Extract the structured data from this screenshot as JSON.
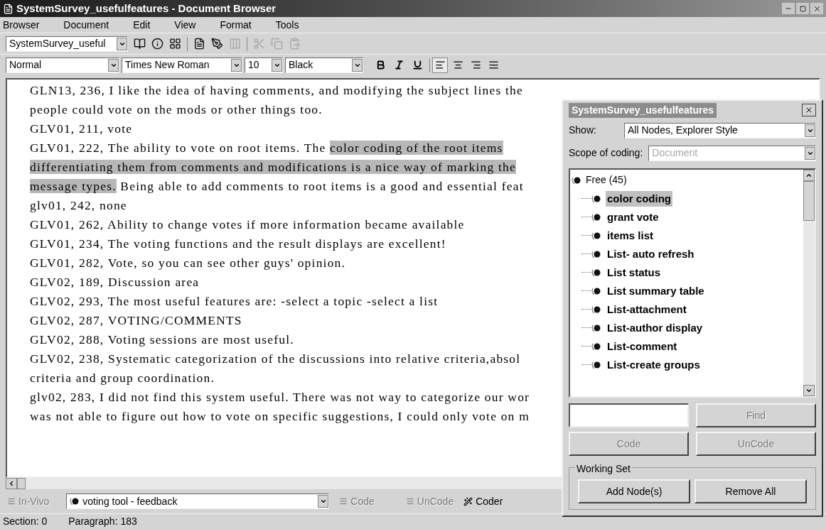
{
  "window": {
    "title": "SystemSurvey_usefulfeatures - Document Browser"
  },
  "menu": [
    {
      "label": "Browser"
    },
    {
      "label": "Document"
    },
    {
      "label": "Edit"
    },
    {
      "label": "View"
    },
    {
      "label": "Format"
    },
    {
      "label": "Tools"
    }
  ],
  "toolbar": {
    "document": "SystemSurvey_useful",
    "tools": [
      {
        "kind": "book",
        "disabled": false
      },
      {
        "kind": "info",
        "disabled": false
      },
      {
        "kind": "grid",
        "disabled": false
      },
      {
        "kind": "document",
        "disabled": false
      },
      {
        "kind": "pen",
        "disabled": false
      },
      {
        "kind": "columns",
        "disabled": true
      },
      {
        "kind": "cut",
        "disabled": true
      },
      {
        "kind": "copy",
        "disabled": true
      },
      {
        "kind": "paste",
        "disabled": true
      }
    ]
  },
  "format_bar": {
    "style": "Normal",
    "font": "Times New Roman",
    "size": "10",
    "color_name": "Black",
    "align": [
      {
        "kind": "left",
        "selected": true
      },
      {
        "kind": "center",
        "selected": false
      },
      {
        "kind": "right",
        "selected": false
      },
      {
        "kind": "justify",
        "selected": false
      }
    ]
  },
  "document": {
    "lines": [
      [
        {
          "text": "GLN13, 236, I like the idea of having comments, and modifying the subject lines the",
          "coded": false
        }
      ],
      [
        {
          "text": "people could vote on the mods or other things too.",
          "coded": false
        }
      ],
      [
        {
          "text": "GLV01, 211, vote",
          "coded": false
        }
      ],
      [
        {
          "text": "GLV01, 222, The ability to vote on root items. The ",
          "coded": false
        },
        {
          "text": "color coding of the root items",
          "coded": true
        }
      ],
      [
        {
          "text": "differentiating them from comments and modifications is a nice way of marking the",
          "coded": true
        }
      ],
      [
        {
          "text": "message types.",
          "coded": true
        },
        {
          "text": " Being able to add comments to root items is a good and essential feat",
          "coded": false
        }
      ],
      [
        {
          "text": "glv01, 242, none",
          "coded": false
        }
      ],
      [
        {
          "text": "GLV01, 262, Ability to change votes if more information became available",
          "coded": false
        }
      ],
      [
        {
          "text": "GLV01, 234, The voting functions and the result displays are excellent!",
          "coded": false
        }
      ],
      [
        {
          "text": "GLV01, 282, Vote, so you can see other guys' opinion.",
          "coded": false
        }
      ],
      [
        {
          "text": "GLV02, 189, Discussion area",
          "coded": false
        }
      ],
      [
        {
          "text": "GLV02, 293, The most useful features are: -select a topic -select a list",
          "coded": false
        }
      ],
      [
        {
          "text": "GLV02, 287, VOTING/COMMENTS",
          "coded": false
        }
      ],
      [
        {
          "text": "GLV02, 288, Voting sessions are most useful.",
          "coded": false
        }
      ],
      [
        {
          "text": "GLV02, 238, Systematic categorization of the discussions into relative criteria,absol",
          "coded": false
        }
      ],
      [
        {
          "text": "criteria and group coordination.",
          "coded": false
        }
      ],
      [
        {
          "text": "glv02, 283, I did not find this system useful. There was not way to categorize our wor",
          "coded": false
        }
      ],
      [
        {
          "text": "was not able to figure out how to vote on specific suggestions, I could only vote on m",
          "coded": false
        }
      ]
    ]
  },
  "coding_bar": {
    "in_vivo": {
      "label": "In-Vivo",
      "disabled": true
    },
    "node": "voting tool - feedback",
    "code": {
      "label": "Code",
      "disabled": true
    },
    "uncode": {
      "label": "UnCode",
      "disabled": true
    },
    "coder": {
      "label": "Coder",
      "disabled": false
    }
  },
  "status_bar": {
    "section": "Section: 0",
    "paragraph": "Paragraph: 183"
  },
  "dialog": {
    "title": "SystemSurvey_usefulfeatures",
    "show_label": "Show:",
    "show_value": "All Nodes, Explorer Style",
    "scope_label": "Scope of coding:",
    "scope_value": "Document",
    "scope_disabled": true,
    "tree": {
      "label": "Free (45)",
      "children": [
        {
          "label": "color coding",
          "selected": true
        },
        {
          "label": "grant vote",
          "selected": false
        },
        {
          "label": "items list",
          "selected": false
        },
        {
          "label": "List- auto refresh",
          "selected": false
        },
        {
          "label": "List status",
          "selected": false
        },
        {
          "label": "List summary table",
          "selected": false
        },
        {
          "label": "List-attachment",
          "selected": false
        },
        {
          "label": "List-author display",
          "selected": false
        },
        {
          "label": "List-comment",
          "selected": false
        },
        {
          "label": "List-create groups",
          "selected": false
        }
      ]
    },
    "find": {
      "label": "Find",
      "disabled": true
    },
    "code": {
      "label": "Code",
      "disabled": true
    },
    "uncode": {
      "label": "UnCode",
      "disabled": true
    },
    "working_set": {
      "title": "Working Set",
      "buttons": [
        "Add Node(s)",
        "Remove All"
      ]
    }
  }
}
